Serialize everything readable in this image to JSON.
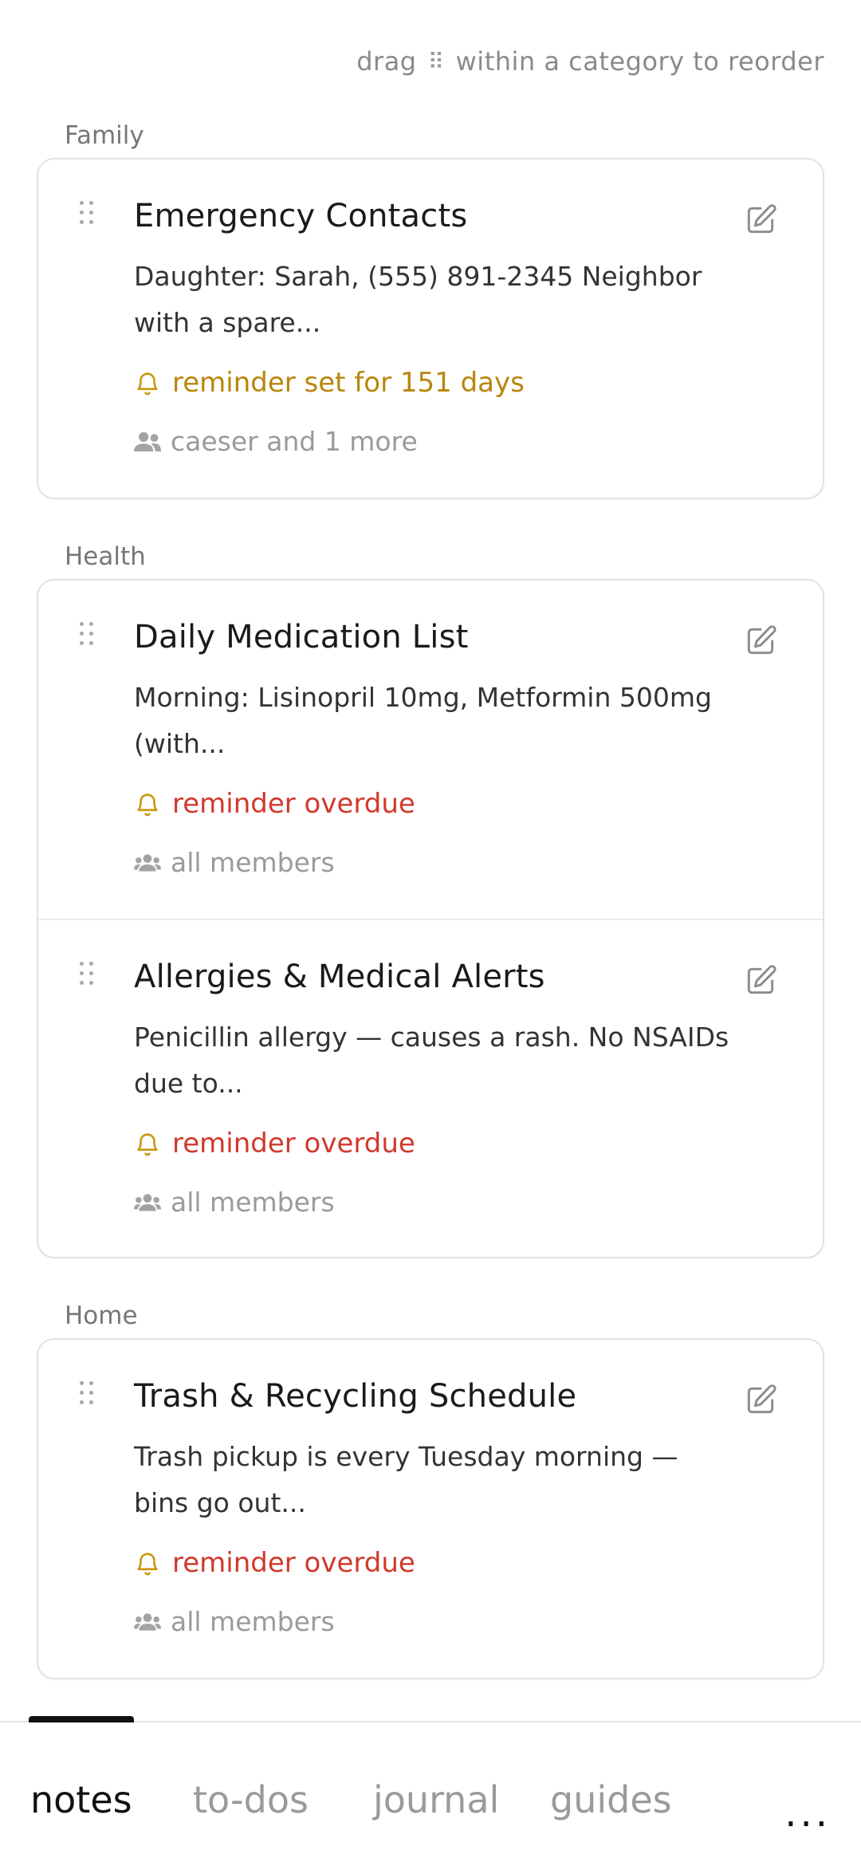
{
  "hint": {
    "prefix": "drag",
    "suffix": "within a category to reorder"
  },
  "categories": [
    {
      "label": "Family",
      "notes": [
        {
          "title": "Emergency Contacts",
          "snippet": "Daughter: Sarah, (555) 891-2345 Neighbor with a spare...",
          "reminder": "reminder set for 151 days",
          "reminder_status": "set",
          "members": "caeser and 1 more"
        }
      ]
    },
    {
      "label": "Health",
      "notes": [
        {
          "title": "Daily Medication List",
          "snippet": "Morning: Lisinopril 10mg, Metformin 500mg (with...",
          "reminder": "reminder overdue",
          "reminder_status": "overdue",
          "members": "all members"
        },
        {
          "title": "Allergies & Medical Alerts",
          "snippet": "Penicillin allergy — causes a rash. No NSAIDs due to...",
          "reminder": "reminder overdue",
          "reminder_status": "overdue",
          "members": "all members"
        }
      ]
    },
    {
      "label": "Home",
      "notes": [
        {
          "title": "Trash & Recycling Schedule",
          "snippet": "Trash pickup is every Tuesday morning — bins go out...",
          "reminder": "reminder overdue",
          "reminder_status": "overdue",
          "members": "all members"
        }
      ]
    }
  ],
  "tabs": [
    {
      "label": "notes",
      "active": true
    },
    {
      "label": "to-dos",
      "active": false
    },
    {
      "label": "journal",
      "active": false
    },
    {
      "label": "guides",
      "active": false
    }
  ],
  "more_label": "...",
  "colors": {
    "reminder_set": "#b8860b",
    "reminder_overdue": "#d0392b",
    "bell_icon": "#c9960c",
    "muted_text": "#9a9a9a"
  },
  "icons": {
    "grip": "drag-handle-icon",
    "edit": "pencil-edit-icon",
    "bell": "bell-icon",
    "members_partial": "user-group-icon",
    "members_all": "users-group-icon"
  }
}
